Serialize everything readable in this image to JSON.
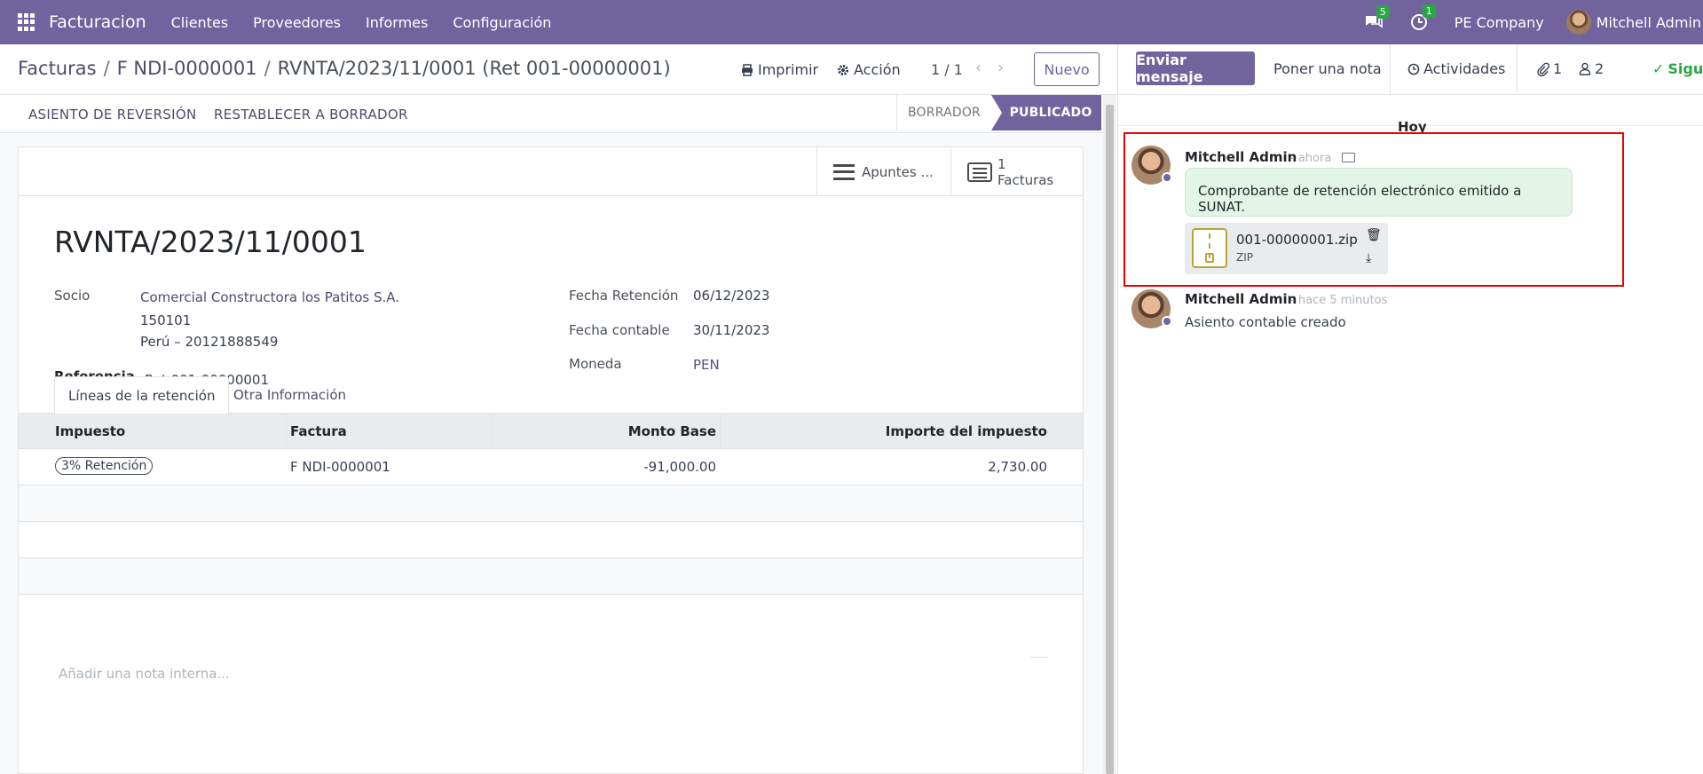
{
  "navbar": {
    "app_name": "Facturacion",
    "menu": [
      "Clientes",
      "Proveedores",
      "Informes",
      "Configuración"
    ],
    "messages_count": "5",
    "activities_count": "1",
    "company": "PE Company",
    "user": "Mitchell Admin",
    "bg_color": "#71639e"
  },
  "control": {
    "breadcrumb": [
      "Facturas",
      "F NDI-0000001",
      "RVNTA/2023/11/0001 (Ret 001-00000001)"
    ],
    "print_label": "Imprimir",
    "action_label": "Acción",
    "pager": "1 / 1",
    "new_label": "Nuevo"
  },
  "statusbar": {
    "reverse_label": "ASIENTO DE REVERSIÓN",
    "reset_label": "RESTABLECER A BORRADOR",
    "states": [
      "BORRADOR",
      "PUBLICADO"
    ],
    "active_state": "PUBLICADO"
  },
  "smart_buttons": {
    "journal_items": "Apuntes ...",
    "invoices_count": "1",
    "invoices_label": "Facturas"
  },
  "record": {
    "name": "RVNTA/2023/11/0001",
    "partner_label": "Socio",
    "partner_name": "Comercial Constructora los Patitos S.A.",
    "partner_zip": "150101",
    "partner_country_vat": "Perú – 20121888549",
    "ref_label": "Referencia",
    "ref_value": "Ret 001-00000001",
    "retention_date_label": "Fecha Retención",
    "retention_date": "06/12/2023",
    "accounting_date_label": "Fecha contable",
    "accounting_date": "30/11/2023",
    "currency_label": "Moneda",
    "currency": "PEN"
  },
  "tabs": [
    "Líneas de la retención",
    "Otra Información"
  ],
  "table": {
    "headers": [
      "Impuesto",
      "Factura",
      "Monto Base",
      "Importe del impuesto"
    ],
    "rows": [
      {
        "tax": "3% Retención",
        "invoice": "F NDI-0000001",
        "base": "-91,000.00",
        "amount": "2,730.00"
      }
    ]
  },
  "note_placeholder": "Añadir una nota interna...",
  "chatter": {
    "send_label": "Enviar mensaje",
    "note_label": "Poner una nota",
    "activities_label": "Actividades",
    "attachments_count": "1",
    "followers_count": "2",
    "follow_label": "Siguiendo",
    "day_separator": "Hoy",
    "messages": [
      {
        "author": "Mitchell Admin",
        "when": "- ahora",
        "body": "Comprobante de retención electrónico emitido a SUNAT.",
        "attachment_name": "001-00000001.zip",
        "attachment_type": "ZIP"
      },
      {
        "author": "Mitchell Admin",
        "when": "- hace 5 minutos",
        "body": "Asiento contable creado"
      }
    ]
  }
}
